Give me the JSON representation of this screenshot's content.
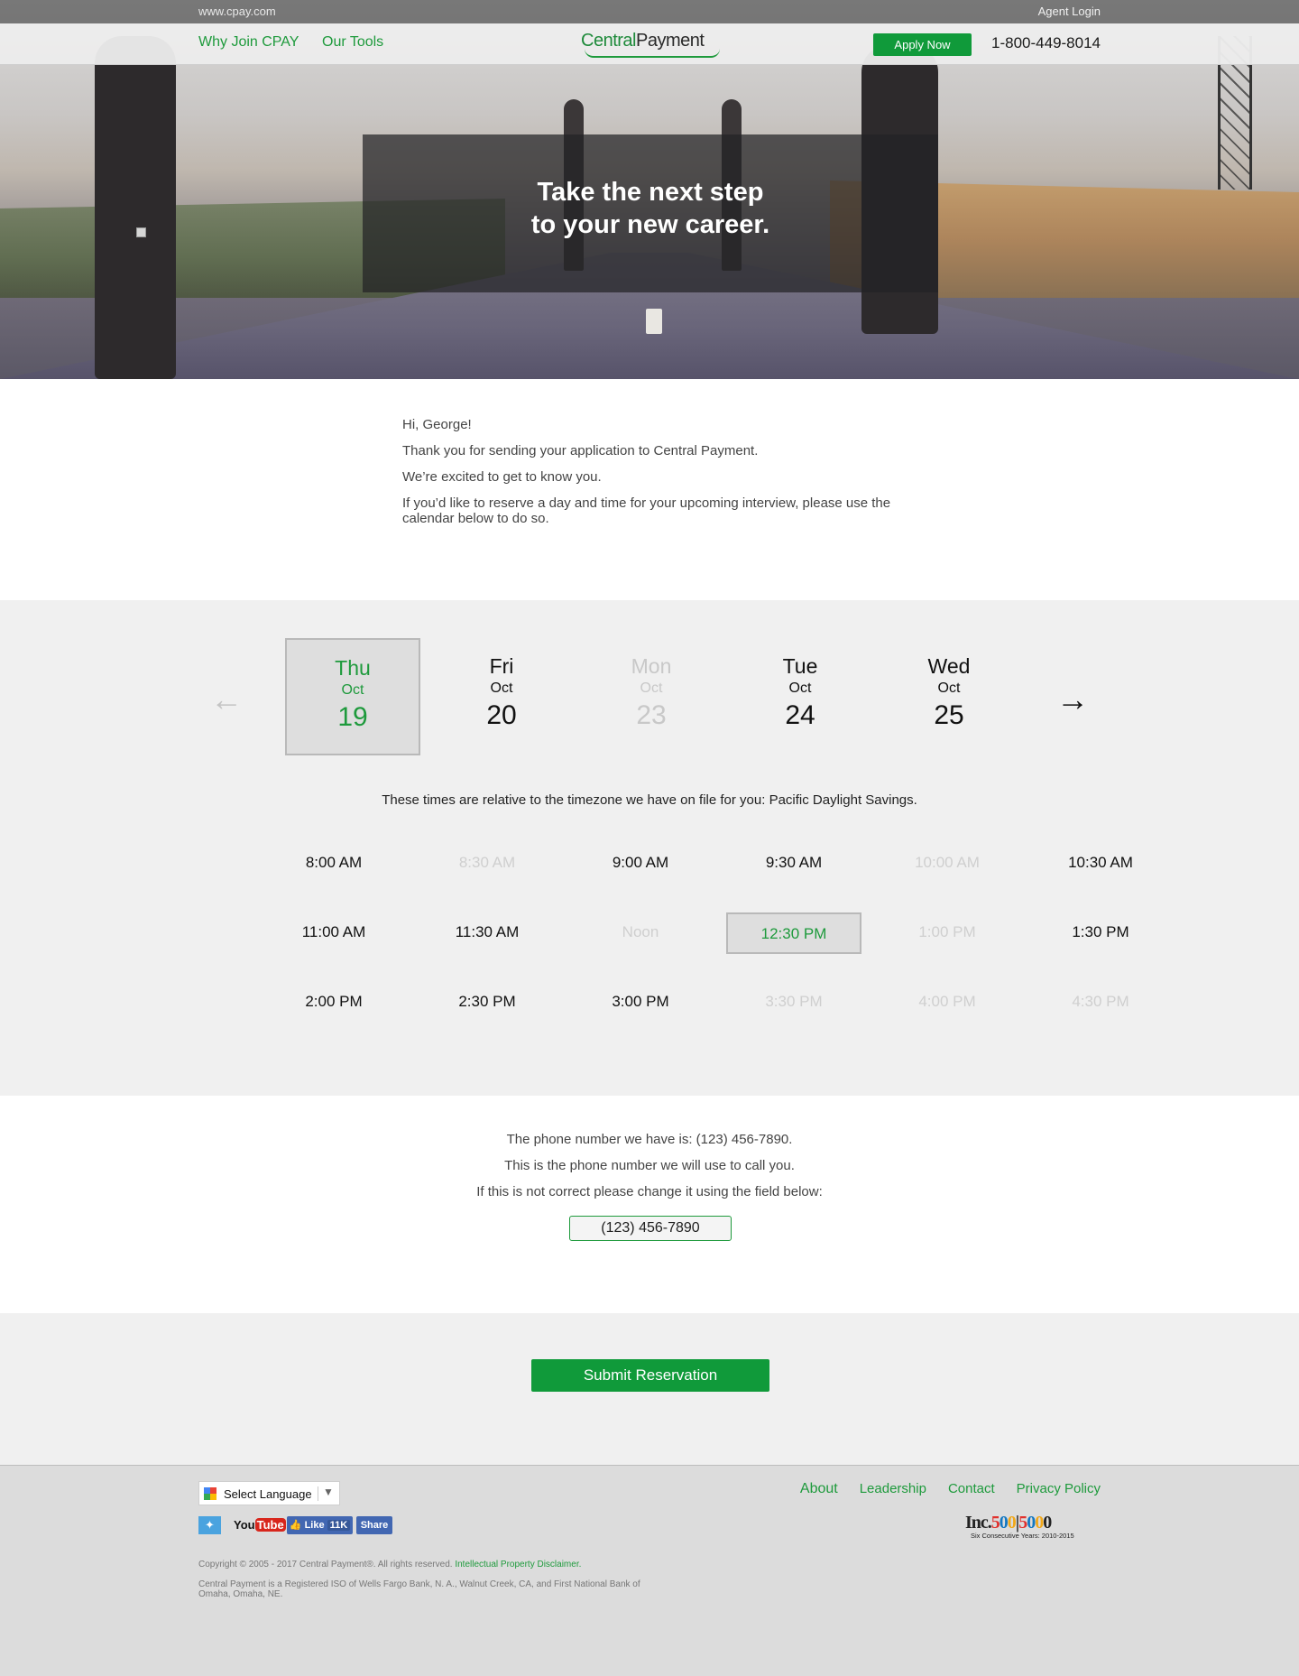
{
  "topbar": {
    "domain": "www.cpay.com",
    "agent_login": "Agent Login"
  },
  "nav": {
    "why_join": "Why Join CPAY",
    "our_tools": "Our Tools",
    "logo_text_central": "Central",
    "logo_text_payment": "Payment",
    "apply_now": "Apply Now",
    "phone": "1-800-449-8014"
  },
  "hero": {
    "line1": "Take the next step",
    "line2": "to your new career."
  },
  "greeting": {
    "hello": "Hi, George!",
    "thanks": "Thank you for sending your application to Central Payment.",
    "excited": "We’re excited to get to know you.",
    "instructions": "If you’d like to reserve a day and time for your upcoming interview, please use the calendar below to do so."
  },
  "calendar": {
    "days": [
      {
        "dow": "Thu",
        "month": "Oct",
        "date": "19",
        "state": "selected"
      },
      {
        "dow": "Fri",
        "month": "Oct",
        "date": "20",
        "state": "available"
      },
      {
        "dow": "Mon",
        "month": "Oct",
        "date": "23",
        "state": "unavailable"
      },
      {
        "dow": "Tue",
        "month": "Oct",
        "date": "24",
        "state": "available"
      },
      {
        "dow": "Wed",
        "month": "Oct",
        "date": "25",
        "state": "available"
      }
    ],
    "timezone_note": "These times are relative to the timezone we have on file for you: Pacific Daylight Savings.",
    "slots": [
      {
        "label": "8:00 AM",
        "state": "available"
      },
      {
        "label": "8:30 AM",
        "state": "unavailable"
      },
      {
        "label": "9:00 AM",
        "state": "available"
      },
      {
        "label": "9:30 AM",
        "state": "available"
      },
      {
        "label": "10:00 AM",
        "state": "unavailable"
      },
      {
        "label": "10:30 AM",
        "state": "available"
      },
      {
        "label": "11:00 AM",
        "state": "available"
      },
      {
        "label": "11:30 AM",
        "state": "available"
      },
      {
        "label": "Noon",
        "state": "unavailable"
      },
      {
        "label": "12:30 PM",
        "state": "selected"
      },
      {
        "label": "1:00 PM",
        "state": "unavailable"
      },
      {
        "label": "1:30 PM",
        "state": "available"
      },
      {
        "label": "2:00 PM",
        "state": "available"
      },
      {
        "label": "2:30 PM",
        "state": "available"
      },
      {
        "label": "3:00 PM",
        "state": "available"
      },
      {
        "label": "3:30 PM",
        "state": "unavailable"
      },
      {
        "label": "4:00 PM",
        "state": "unavailable"
      },
      {
        "label": "4:30 PM",
        "state": "unavailable"
      }
    ]
  },
  "phone_section": {
    "line1": "The phone number we have is: (123) 456-7890.",
    "line2": "This is the phone number we will use to call you.",
    "line3": "If this is not correct please change it using the field below:",
    "value": "(123) 456-7890"
  },
  "submit": {
    "label": "Submit Reservation"
  },
  "footer": {
    "select_language": "Select Language",
    "links": {
      "about": "About",
      "leadership": "Leadership",
      "contact": "Contact",
      "privacy": "Privacy Policy"
    },
    "fb_like": "Like",
    "fb_count": "11K",
    "fb_share": "Share",
    "youtube_you": "You",
    "youtube_tube": "Tube",
    "copyright": "Copyright © 2005 - 2017 Central Payment®. All rights reserved.",
    "ip_disclaimer": "Intellectual Property Disclaimer.",
    "iso_note": "Central Payment is a Registered ISO of Wells Fargo Bank, N. A., Walnut Creek, CA, and First National Bank of Omaha, Omaha, NE.",
    "inc_logo": "Inc.",
    "inc_sub": "Six Consecutive Years: 2010-2015"
  },
  "colors": {
    "brand_green": "#109a3a",
    "link_green": "#1e9a3c",
    "disabled_gray": "#c8c8c8"
  }
}
